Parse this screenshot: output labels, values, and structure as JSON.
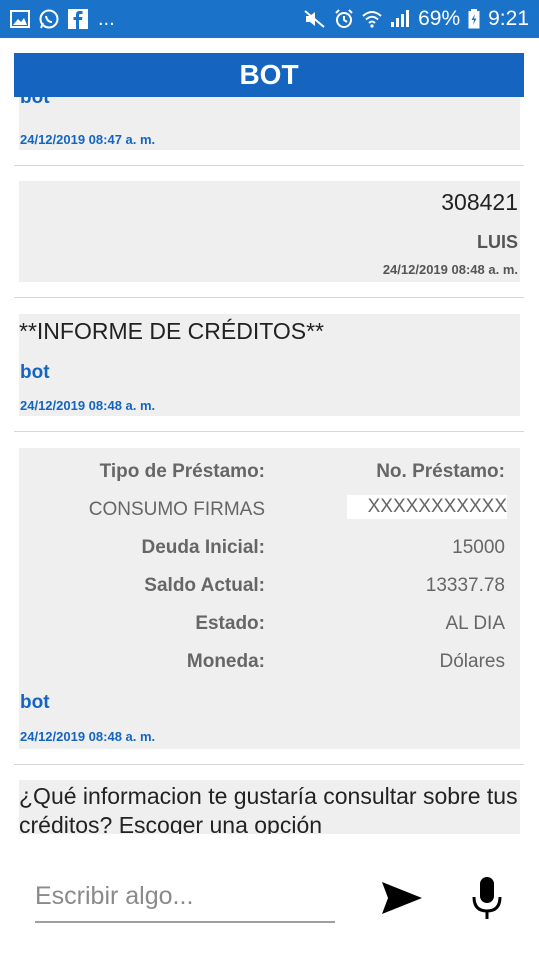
{
  "status_bar": {
    "left_icons": [
      "image-icon",
      "whatsapp-icon",
      "facebook-icon"
    ],
    "overflow": "...",
    "right_icons": [
      "mute-icon",
      "alarm-icon",
      "wifi-icon",
      "signal-icon"
    ],
    "battery": "69%",
    "time": "9:21"
  },
  "header": {
    "title": "BOT"
  },
  "messages": [
    {
      "sender": "bot",
      "timestamp": "24/12/2019 08:47 a. m."
    },
    {
      "text": "308421",
      "sender": "LUIS",
      "timestamp": "24/12/2019 08:48 a. m."
    },
    {
      "text": "**INFORME DE CRÉDITOS**",
      "sender": "bot",
      "timestamp": "24/12/2019 08:48 a. m."
    },
    {
      "loan": {
        "headers": [
          "Tipo de Préstamo:",
          "No. Préstamo:"
        ],
        "type_value": "CONSUMO FIRMAS",
        "number_value": "XXXXXXXXXXX",
        "rows": [
          {
            "label": "Deuda Inicial:",
            "value": "15000"
          },
          {
            "label": "Saldo Actual:",
            "value": "13337.78"
          },
          {
            "label": "Estado:",
            "value": "AL DIA"
          },
          {
            "label": "Moneda:",
            "value": "Dólares"
          }
        ]
      },
      "sender": "bot",
      "timestamp": "24/12/2019 08:48 a. m."
    },
    {
      "text": "¿Qué informacion te gustaría consultar sobre tus créditos? Escoger una opción"
    }
  ],
  "input": {
    "placeholder": "Escribir algo..."
  },
  "colors": {
    "accent": "#1565c0",
    "status_bar": "#1a73c8",
    "bubble": "#efefef"
  }
}
